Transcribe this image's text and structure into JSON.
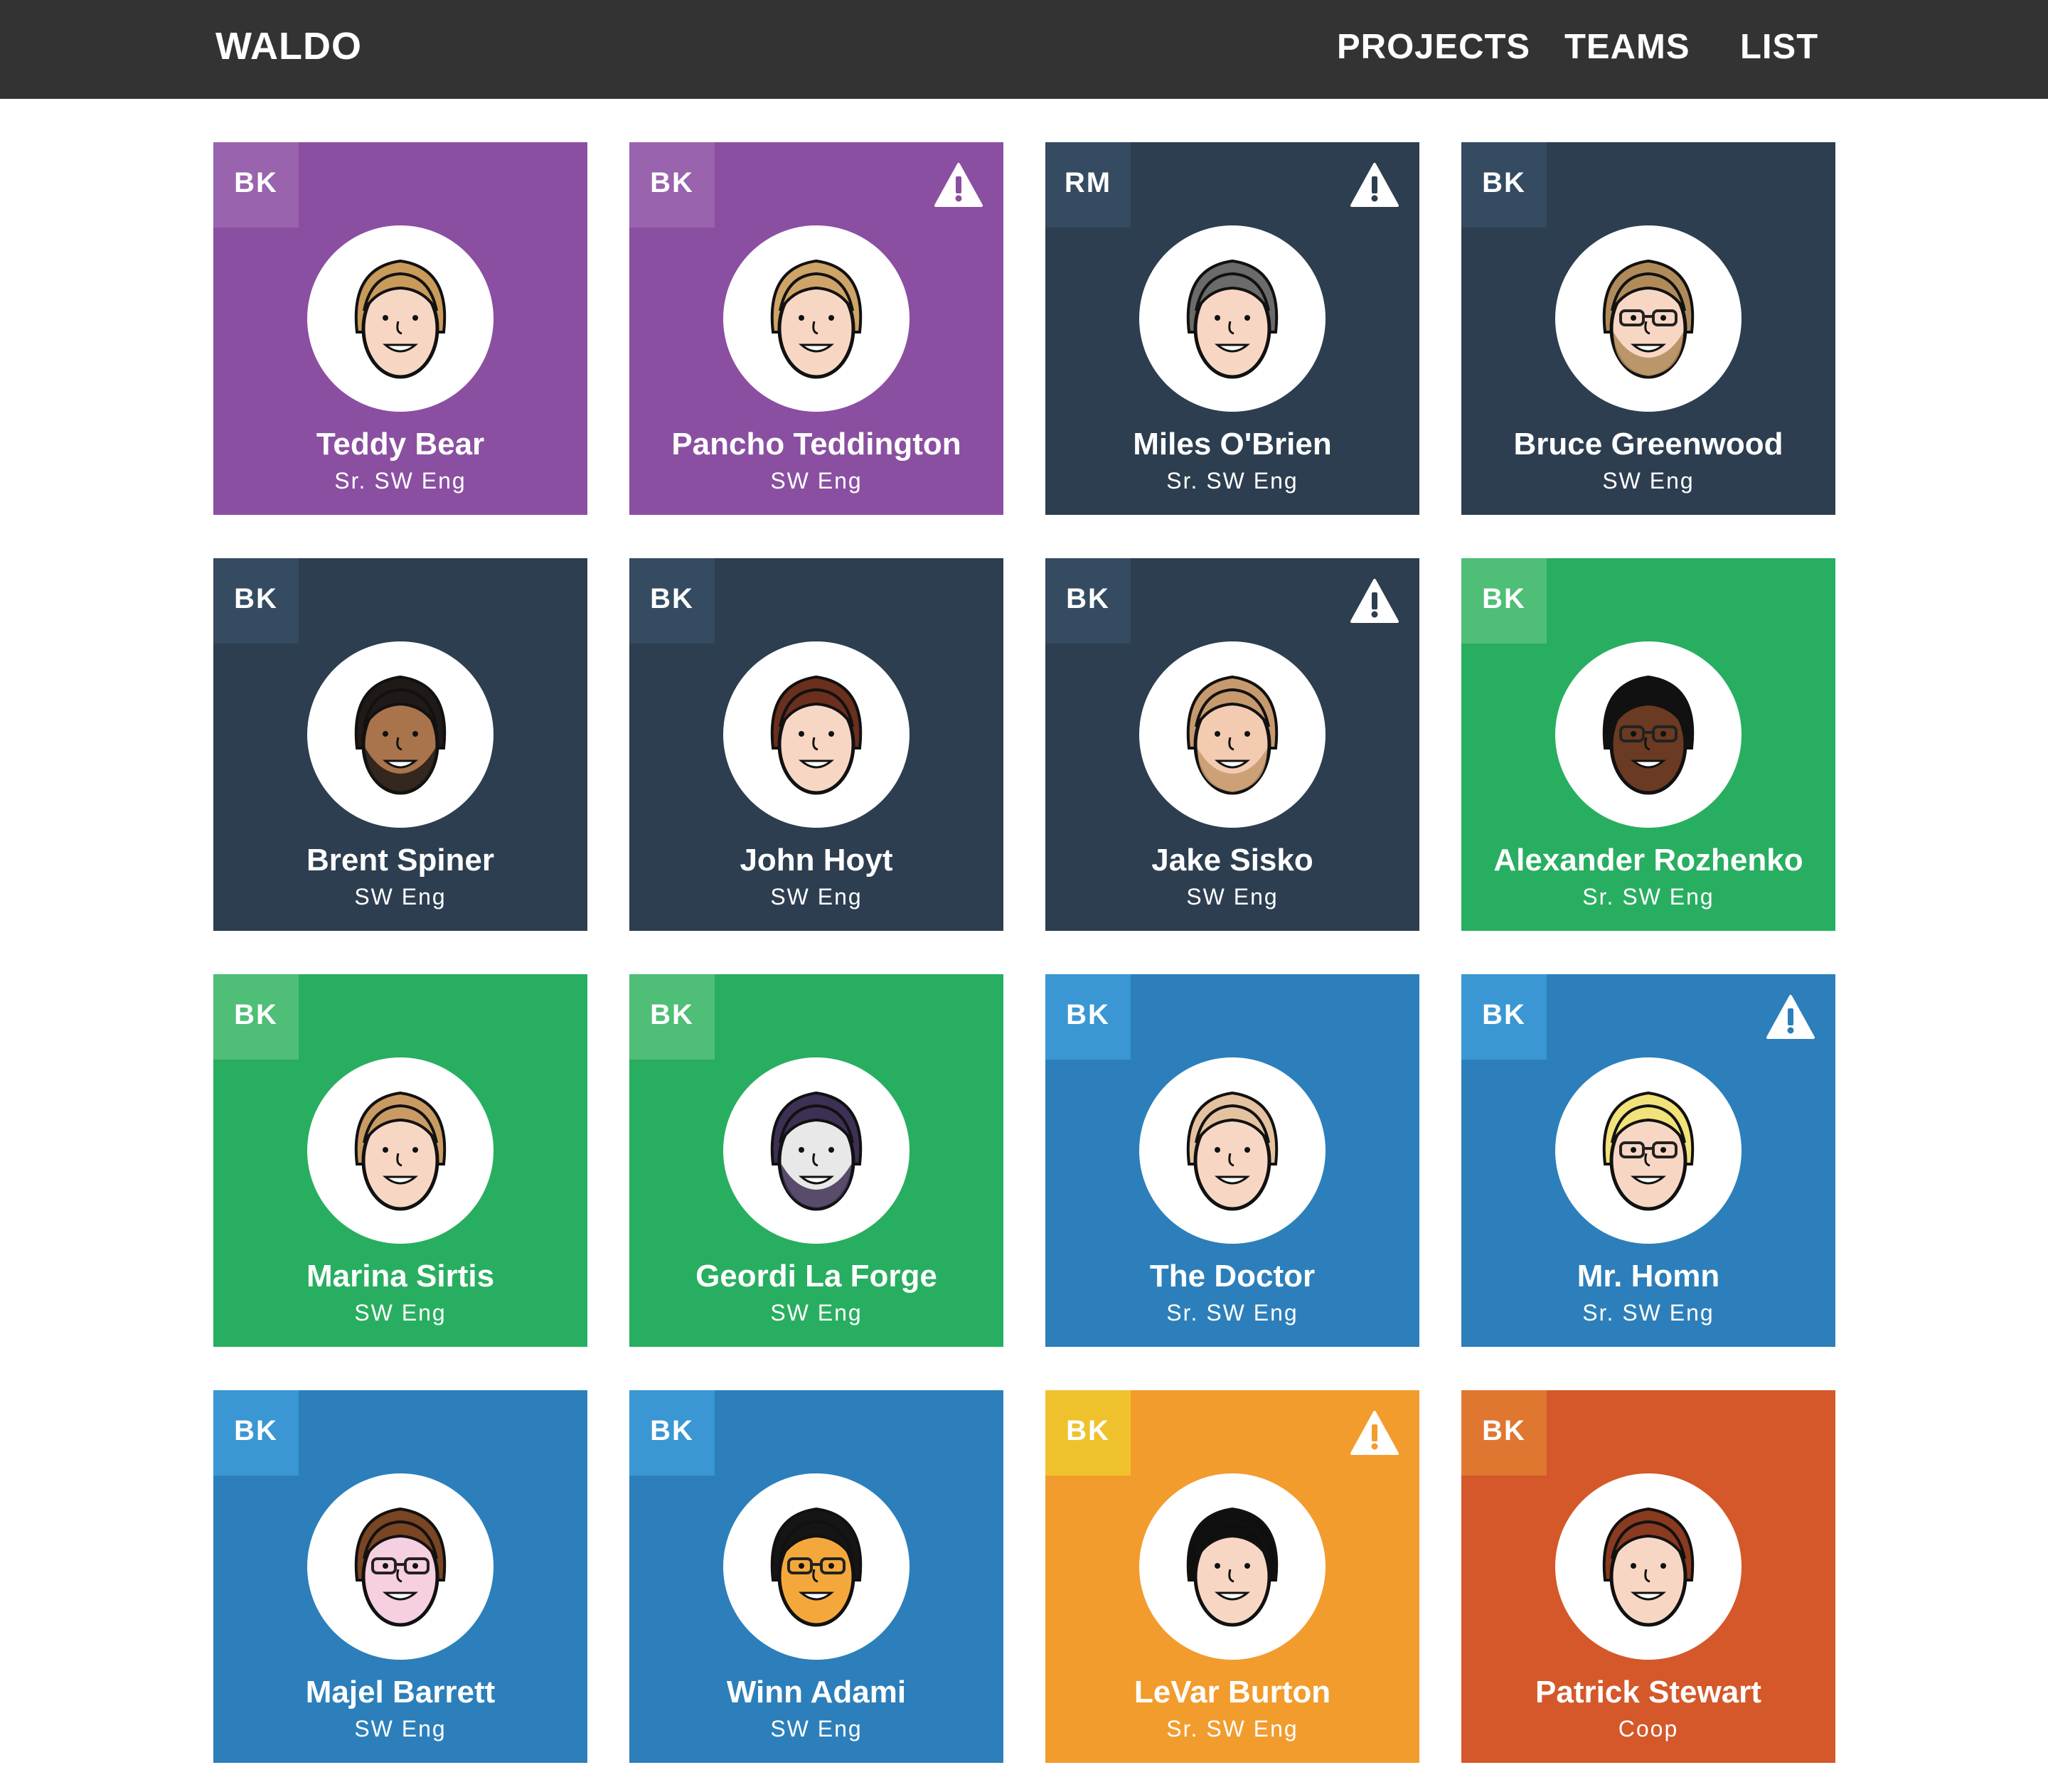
{
  "app": {
    "brand": "WALDO",
    "nav": [
      {
        "label": "PROJECTS"
      },
      {
        "label": "TEAMS"
      },
      {
        "label": "LIST"
      }
    ]
  },
  "colors": {
    "topbar": "#333333",
    "purple": "#8A4FA1",
    "purple_badge": "#9963AE",
    "navy": "#2C3E50",
    "navy_badge": "#344B61",
    "green": "#28AE60",
    "green_badge": "#4FBE76",
    "blue": "#2C7FBA",
    "blue_badge": "#3A97D4",
    "orange": "#F29C2E",
    "orange_badge": "#EFC22D",
    "rust": "#D4582A",
    "rust_badge": "#E07731"
  },
  "cards": [
    {
      "badge": "BK",
      "name": "Teddy Bear",
      "role": "Sr. SW Eng",
      "theme": "purple",
      "warning": false,
      "hair": "#C99A5A",
      "skin": "#F7D7C4",
      "beard": false,
      "glasses": false
    },
    {
      "badge": "BK",
      "name": "Pancho Teddington",
      "role": "SW Eng",
      "theme": "purple",
      "warning": true,
      "hair": "#CFA468",
      "skin": "#F7D7C4",
      "beard": false,
      "glasses": false
    },
    {
      "badge": "RM",
      "name": "Miles O'Brien",
      "role": "Sr. SW Eng",
      "theme": "navy",
      "warning": true,
      "hair": "#6B6B6B",
      "skin": "#F7D7C4",
      "beard": false,
      "glasses": false
    },
    {
      "badge": "BK",
      "name": "Bruce Greenwood",
      "role": "SW Eng",
      "theme": "navy",
      "warning": false,
      "hair": "#B08B5A",
      "skin": "#F7D7C4",
      "beard": true,
      "glasses": true
    },
    {
      "badge": "BK",
      "name": "Brent Spiner",
      "role": "SW Eng",
      "theme": "navy",
      "warning": false,
      "hair": "#1F1A17",
      "skin": "#A9744B",
      "beard": true,
      "glasses": false
    },
    {
      "badge": "BK",
      "name": "John Hoyt",
      "role": "SW Eng",
      "theme": "navy",
      "warning": false,
      "hair": "#6B2F1E",
      "skin": "#F7D7C4",
      "beard": false,
      "glasses": false
    },
    {
      "badge": "BK",
      "name": "Jake Sisko",
      "role": "SW Eng",
      "theme": "navy",
      "warning": true,
      "hair": "#C79A6E",
      "skin": "#F2CBB0",
      "beard": true,
      "glasses": false
    },
    {
      "badge": "BK",
      "name": "Alexander Rozhenko",
      "role": "Sr. SW Eng",
      "theme": "green",
      "warning": false,
      "hair": "#111111",
      "skin": "#6A3A22",
      "beard": false,
      "glasses": true
    },
    {
      "badge": "BK",
      "name": "Marina Sirtis",
      "role": "SW Eng",
      "theme": "green",
      "warning": false,
      "hair": "#C99B63",
      "skin": "#F7D7C4",
      "beard": false,
      "glasses": false
    },
    {
      "badge": "BK",
      "name": "Geordi La Forge",
      "role": "SW Eng",
      "theme": "green",
      "warning": false,
      "hair": "#3E3054",
      "skin": "#E8E8E8",
      "beard": true,
      "glasses": false
    },
    {
      "badge": "BK",
      "name": "The Doctor",
      "role": "Sr. SW Eng",
      "theme": "blue",
      "warning": false,
      "hair": "#E5C29F",
      "skin": "#F7D7C4",
      "beard": false,
      "glasses": false
    },
    {
      "badge": "BK",
      "name": "Mr. Homn",
      "role": "Sr. SW Eng",
      "theme": "blue",
      "warning": true,
      "hair": "#F2E27A",
      "skin": "#F7D7C4",
      "beard": false,
      "glasses": true
    },
    {
      "badge": "BK",
      "name": "Majel Barrett",
      "role": "SW Eng",
      "theme": "blue",
      "warning": false,
      "hair": "#7A4522",
      "skin": "#F6CFE0",
      "beard": false,
      "glasses": true
    },
    {
      "badge": "BK",
      "name": "Winn Adami",
      "role": "SW Eng",
      "theme": "blue",
      "warning": false,
      "hair": "#151515",
      "skin": "#F4A83C",
      "beard": false,
      "glasses": true
    },
    {
      "badge": "BK",
      "name": "LeVar Burton",
      "role": "Sr. SW Eng",
      "theme": "orange",
      "warning": true,
      "hair": "#0F0F0F",
      "skin": "#F7D7C4",
      "beard": false,
      "glasses": false
    },
    {
      "badge": "BK",
      "name": "Patrick Stewart",
      "role": "Coop",
      "theme": "rust",
      "warning": false,
      "hair": "#8A3A1E",
      "skin": "#F7D7C4",
      "beard": false,
      "glasses": false
    }
  ]
}
